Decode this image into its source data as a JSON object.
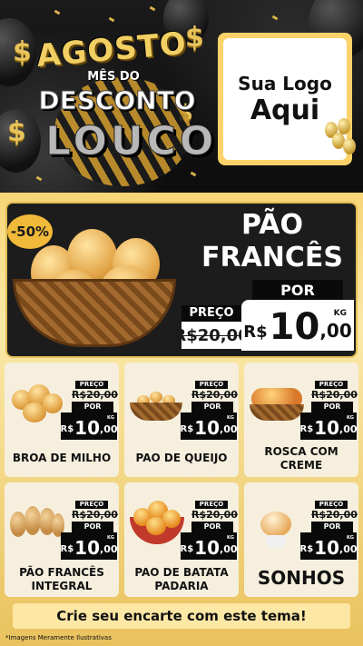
{
  "header": {
    "line1": "AGOSTO",
    "line2": "MÊS DO",
    "line3": "DESCONTO",
    "line4": "LOUCO",
    "dollar_sign": "$"
  },
  "logo": {
    "line1": "Sua Logo",
    "line2": "Aqui"
  },
  "hero": {
    "discount_badge": "-50%",
    "name_line1": "PÃO",
    "name_line2": "FRANCÊS",
    "preco_label": "PREÇO",
    "old_price": "R$20,00",
    "por_label": "POR",
    "currency": "R$",
    "new_int": "10",
    "new_dec": ",00",
    "unit": "KG"
  },
  "products": [
    {
      "name": "BROA DE MILHO",
      "preco_label": "PREÇO",
      "old_price": "R$20,00",
      "por_label": "POR",
      "currency": "R$",
      "new_int": "10",
      "new_dec": ",00",
      "unit": "KG"
    },
    {
      "name": "PAO DE QUEIJO",
      "preco_label": "PREÇO",
      "old_price": "R$20,00",
      "por_label": "POR",
      "currency": "R$",
      "new_int": "10",
      "new_dec": ",00",
      "unit": "KG"
    },
    {
      "name": "ROSCA COM CREME",
      "preco_label": "PREÇO",
      "old_price": "R$20,00",
      "por_label": "POR",
      "currency": "R$",
      "new_int": "10",
      "new_dec": ",00",
      "unit": "KG"
    },
    {
      "name": "PÃO FRANCÊS INTEGRAL",
      "preco_label": "PREÇO",
      "old_price": "R$20,00",
      "por_label": "POR",
      "currency": "R$",
      "new_int": "10",
      "new_dec": ",00",
      "unit": "KG"
    },
    {
      "name": "PAO DE BATATA PADARIA",
      "preco_label": "PREÇO",
      "old_price": "R$20,00",
      "por_label": "POR",
      "currency": "R$",
      "new_int": "10",
      "new_dec": ",00",
      "unit": "KG"
    },
    {
      "name": "SONHOS",
      "preco_label": "PREÇO",
      "old_price": "R$20,00",
      "por_label": "POR",
      "currency": "R$",
      "new_int": "10",
      "new_dec": ",00",
      "unit": "KG"
    }
  ],
  "footer": {
    "cta": "Crie seu encarte com este tema!",
    "note": "*Imagens Meramente Ilustrativas"
  },
  "colors": {
    "gold": "#e7c25a",
    "dark": "#0a0a0a",
    "card_bg": "#f6efde"
  }
}
